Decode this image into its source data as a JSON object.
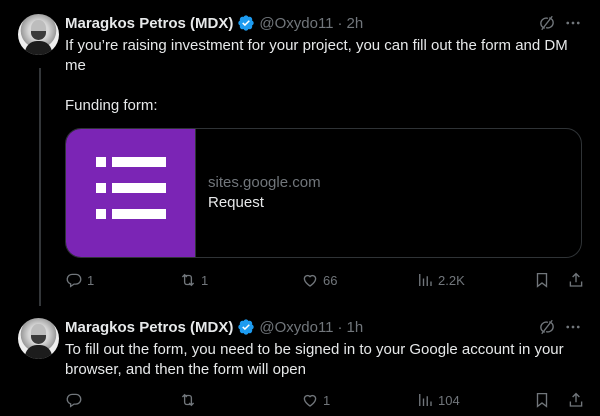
{
  "tweets": [
    {
      "author": {
        "name": "Maragkos Petros (MDX)",
        "handle": "@Oxydo11",
        "verified": true
      },
      "time": "2h",
      "separator": "·",
      "text": "If you’re raising investment for your project, you can fill out the form and DM me\n\nFunding form:",
      "card": {
        "domain": "sites.google.com",
        "title": "Request",
        "thumb_color": "#7b25b5"
      },
      "stats": {
        "replies": "1",
        "reposts": "1",
        "likes": "66",
        "views": "2.2K"
      }
    },
    {
      "author": {
        "name": "Maragkos Petros (MDX)",
        "handle": "@Oxydo11",
        "verified": true
      },
      "time": "1h",
      "separator": "·",
      "text": "To fill out the form, you need to be signed in to your Google account in your browser, and then the form will open",
      "stats": {
        "replies": "",
        "reposts": "",
        "likes": "1",
        "views": "104"
      }
    }
  ],
  "icons": {
    "verified": "verified-badge-icon",
    "grok": "grok-icon",
    "more": "more-icon",
    "reply": "reply-icon",
    "repost": "repost-icon",
    "like": "like-icon",
    "views": "views-icon",
    "bookmark": "bookmark-icon",
    "share": "share-icon"
  },
  "colors": {
    "background": "#000000",
    "text": "#e7e9ea",
    "muted": "#71767b",
    "verified": "#1d9bf0",
    "border": "#2f3336"
  }
}
